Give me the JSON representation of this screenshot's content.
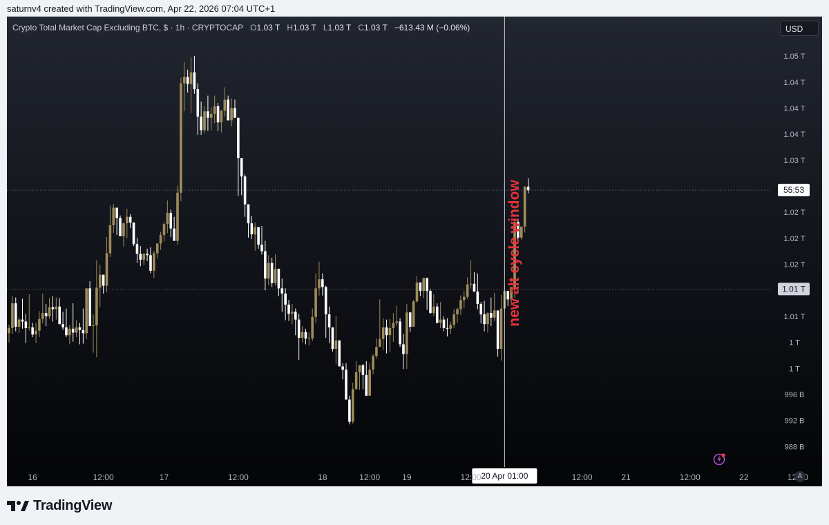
{
  "header": {
    "caption": "saturnv4 created with TradingView.com, Apr 22, 2026 07:04 UTC+1"
  },
  "legend": {
    "title": "Crypto Total Market Cap Excluding BTC, $ · 1h · CRYPTOCAP",
    "open_label": "O",
    "open_value": "1.03 T",
    "high_label": "H",
    "high_value": "1.03 T",
    "low_label": "L",
    "low_value": "1.03 T",
    "close_label": "C",
    "close_value": "1.03 T",
    "change": "−613.43 M (−0.06%)"
  },
  "currency_button": "USD",
  "auto_button": "A",
  "brand": {
    "name": "TradingView"
  },
  "colors": {
    "up_candle": "#a08c5b",
    "down_candle": "#ffffff",
    "annotation": "#e8323b",
    "crosshair": "#cfd2d8",
    "frame_bg": "#16181f"
  },
  "chart_data": {
    "type": "candlestick",
    "title": "Crypto Total Market Cap Excluding BTC, $ · 1h · CRYPTOCAP",
    "y_unit": "USD",
    "ylim": [
      986,
      1055
    ],
    "y_tick_labels": [
      {
        "value": 1050,
        "label": "1.05 T"
      },
      {
        "value": 1046,
        "label": "1.04 T"
      },
      {
        "value": 1042,
        "label": "1.04 T"
      },
      {
        "value": 1038,
        "label": "1.04 T"
      },
      {
        "value": 1034,
        "label": "1.03 T"
      },
      {
        "value": 1026,
        "label": "1.02 T"
      },
      {
        "value": 1022,
        "label": "1.02 T"
      },
      {
        "value": 1018,
        "label": "1.02 T"
      },
      {
        "value": 1010,
        "label": "1.01 T"
      },
      {
        "value": 1006,
        "label": "1 T"
      },
      {
        "value": 1002,
        "label": "1 T"
      },
      {
        "value": 998,
        "label": "996 B"
      },
      {
        "value": 994,
        "label": "992 B"
      },
      {
        "value": 990,
        "label": "988 B"
      }
    ],
    "x_tick_labels": [
      {
        "bar": 7,
        "label": "16"
      },
      {
        "bar": 28,
        "label": "12:00"
      },
      {
        "bar": 46,
        "label": "17"
      },
      {
        "bar": 68,
        "label": "12:00"
      },
      {
        "bar": 93,
        "label": "18"
      },
      {
        "bar": 107,
        "label": "12:00"
      },
      {
        "bar": 118,
        "label": "19"
      },
      {
        "bar": 137,
        "label": "12:00"
      },
      {
        "bar": 170,
        "label": "12:00"
      },
      {
        "bar": 183,
        "label": "21"
      },
      {
        "bar": 202,
        "label": "12:00"
      },
      {
        "bar": 218,
        "label": "22"
      },
      {
        "bar": 234,
        "label": "12:00"
      }
    ],
    "crosshair": {
      "bar": 147,
      "x_label": "20 Apr   01:00"
    },
    "price_labels": [
      {
        "value": 1029.4,
        "label": "55:53",
        "style": "current"
      },
      {
        "value": 1014.2,
        "label": "1.01 T",
        "style": "marker"
      }
    ],
    "annotation": {
      "text": "new alt cycle window",
      "bar": 150,
      "value": 1018
    },
    "candles": [
      [
        1007.4,
        1008.7,
        1006.0,
        1008.2
      ],
      [
        1008.2,
        1013.1,
        1007.3,
        1012.0
      ],
      [
        1012.0,
        1012.9,
        1007.7,
        1008.4
      ],
      [
        1008.4,
        1009.8,
        1007.4,
        1009.5
      ],
      [
        1009.5,
        1012.7,
        1008.1,
        1009.2
      ],
      [
        1009.2,
        1010.4,
        1005.9,
        1008.2
      ],
      [
        1008.2,
        1013.4,
        1007.8,
        1008.3
      ],
      [
        1008.3,
        1009.0,
        1006.8,
        1007.2
      ],
      [
        1007.2,
        1009.0,
        1005.9,
        1007.8
      ],
      [
        1007.8,
        1010.8,
        1006.8,
        1009.6
      ],
      [
        1009.6,
        1013.5,
        1008.9,
        1010.5
      ],
      [
        1010.5,
        1011.9,
        1008.5,
        1010.0
      ],
      [
        1010.0,
        1012.8,
        1009.6,
        1011.4
      ],
      [
        1011.4,
        1013.1,
        1009.2,
        1011.1
      ],
      [
        1011.1,
        1012.9,
        1009.5,
        1011.5
      ],
      [
        1011.5,
        1012.8,
        1008.8,
        1008.8
      ],
      [
        1008.8,
        1010.7,
        1007.9,
        1008.3
      ],
      [
        1008.3,
        1011.2,
        1006.8,
        1007.1
      ],
      [
        1007.1,
        1008.7,
        1005.7,
        1008.1
      ],
      [
        1008.1,
        1012.0,
        1006.1,
        1007.5
      ],
      [
        1007.5,
        1009.4,
        1006.8,
        1008.3
      ],
      [
        1008.3,
        1009.0,
        1005.7,
        1007.9
      ],
      [
        1007.9,
        1011.2,
        1005.8,
        1007.4
      ],
      [
        1007.4,
        1014.1,
        1006.5,
        1014.3
      ],
      [
        1014.3,
        1015.4,
        1008.6,
        1008.5
      ],
      [
        1008.5,
        1010.3,
        1004.4,
        1008.6
      ],
      [
        1008.6,
        1018.6,
        1003.7,
        1014.4
      ],
      [
        1014.4,
        1017.9,
        1011.4,
        1016.4
      ],
      [
        1016.4,
        1015.8,
        1013.5,
        1014.7
      ],
      [
        1014.7,
        1022.2,
        1013.7,
        1019.7
      ],
      [
        1019.7,
        1027.0,
        1019.1,
        1024.0
      ],
      [
        1024.0,
        1027.3,
        1022.8,
        1026.7
      ],
      [
        1026.7,
        1026.7,
        1022.5,
        1025.1
      ],
      [
        1025.1,
        1025.5,
        1022.3,
        1022.3
      ],
      [
        1022.3,
        1024.4,
        1020.7,
        1024.3
      ],
      [
        1024.3,
        1026.5,
        1022.0,
        1025.3
      ],
      [
        1025.3,
        1025.7,
        1023.6,
        1024.4
      ],
      [
        1024.4,
        1024.2,
        1020.8,
        1021.1
      ],
      [
        1021.1,
        1022.1,
        1018.2,
        1019.6
      ],
      [
        1019.6,
        1020.8,
        1017.7,
        1018.7
      ],
      [
        1018.7,
        1019.7,
        1017.9,
        1019.6
      ],
      [
        1019.6,
        1020.4,
        1018.5,
        1019.4
      ],
      [
        1019.4,
        1020.6,
        1016.6,
        1017.0
      ],
      [
        1017.0,
        1020.0,
        1015.9,
        1019.7
      ],
      [
        1019.7,
        1021.2,
        1018.9,
        1021.2
      ],
      [
        1021.2,
        1023.0,
        1020.2,
        1022.5
      ],
      [
        1022.5,
        1024.5,
        1021.5,
        1024.2
      ],
      [
        1024.2,
        1027.8,
        1022.8,
        1025.9
      ],
      [
        1025.9,
        1026.4,
        1022.2,
        1023.5
      ],
      [
        1023.5,
        1025.3,
        1022.9,
        1021.6
      ],
      [
        1021.6,
        1030.1,
        1021.0,
        1029.0
      ],
      [
        1029.0,
        1046.7,
        1027.7,
        1045.8
      ],
      [
        1045.8,
        1049.1,
        1041.5,
        1046.8
      ],
      [
        1046.8,
        1047.9,
        1044.4,
        1045.7
      ],
      [
        1045.7,
        1049.8,
        1041.2,
        1047.5
      ],
      [
        1047.5,
        1050.0,
        1044.2,
        1044.9
      ],
      [
        1044.9,
        1045.8,
        1037.9,
        1040.7
      ],
      [
        1040.7,
        1043.0,
        1037.9,
        1038.6
      ],
      [
        1038.6,
        1042.3,
        1038.2,
        1041.5
      ],
      [
        1041.5,
        1043.9,
        1038.5,
        1040.5
      ],
      [
        1040.5,
        1042.1,
        1038.6,
        1041.1
      ],
      [
        1041.1,
        1043.9,
        1039.7,
        1042.3
      ],
      [
        1042.3,
        1042.8,
        1038.5,
        1039.8
      ],
      [
        1039.8,
        1041.7,
        1038.3,
        1041.6
      ],
      [
        1041.6,
        1045.2,
        1040.7,
        1043.3
      ],
      [
        1043.3,
        1043.9,
        1040.3,
        1040.1
      ],
      [
        1040.1,
        1043.5,
        1039.2,
        1042.0
      ],
      [
        1042.0,
        1043.3,
        1040.5,
        1040.5
      ],
      [
        1040.5,
        1040.4,
        1028.5,
        1034.3
      ],
      [
        1034.3,
        1034.0,
        1028.6,
        1031.5
      ],
      [
        1031.5,
        1031.8,
        1025.3,
        1027.2
      ],
      [
        1027.2,
        1027.2,
        1022.1,
        1024.3
      ],
      [
        1024.3,
        1025.4,
        1021.9,
        1022.6
      ],
      [
        1022.6,
        1024.4,
        1020.1,
        1023.7
      ],
      [
        1023.7,
        1023.7,
        1020.4,
        1021.0
      ],
      [
        1021.0,
        1023.9,
        1019.5,
        1020.0
      ],
      [
        1020.0,
        1021.6,
        1014.0,
        1015.8
      ],
      [
        1015.8,
        1019.4,
        1014.8,
        1018.2
      ],
      [
        1018.2,
        1019.0,
        1014.5,
        1015.1
      ],
      [
        1015.1,
        1019.5,
        1014.7,
        1017.3
      ],
      [
        1017.3,
        1016.7,
        1013.1,
        1014.3
      ],
      [
        1014.3,
        1015.8,
        1010.7,
        1013.5
      ],
      [
        1013.5,
        1014.3,
        1009.4,
        1011.8
      ],
      [
        1011.8,
        1012.5,
        1009.3,
        1010.4
      ],
      [
        1010.4,
        1011.9,
        1008.8,
        1010.7
      ],
      [
        1010.7,
        1011.2,
        1007.1,
        1009.5
      ],
      [
        1009.5,
        1010.4,
        1003.3,
        1006.7
      ],
      [
        1006.7,
        1008.5,
        1006.0,
        1007.6
      ],
      [
        1007.6,
        1008.1,
        1005.7,
        1006.6
      ],
      [
        1006.6,
        1007.5,
        1005.5,
        1006.6
      ],
      [
        1006.6,
        1011.2,
        1006.2,
        1009.9
      ],
      [
        1009.9,
        1016.6,
        1009.0,
        1014.3
      ],
      [
        1014.3,
        1018.4,
        1013.2,
        1015.7
      ],
      [
        1015.7,
        1016.6,
        1013.2,
        1014.5
      ],
      [
        1014.5,
        1014.7,
        1006.7,
        1010.3
      ],
      [
        1010.3,
        1011.5,
        1005.9,
        1008.3
      ],
      [
        1008.3,
        1007.9,
        1004.6,
        1005.0
      ],
      [
        1005.0,
        1010.1,
        1002.6,
        1006.3
      ],
      [
        1006.3,
        1005.7,
        1002.9,
        1002.3
      ],
      [
        1002.3,
        1002.8,
        1000.3,
        1001.8
      ],
      [
        1001.8,
        1002.8,
        997.4,
        997.2
      ],
      [
        997.2,
        997.8,
        993.4,
        993.8
      ],
      [
        993.8,
        999.8,
        993.5,
        998.8
      ],
      [
        998.8,
        1003.1,
        1000.4,
        1001.4
      ],
      [
        1001.4,
        1001.8,
        998.7,
        1002.5
      ],
      [
        1002.5,
        1002.7,
        998.8,
        1001.0
      ],
      [
        1001.0,
        1003.1,
        998.4,
        997.8
      ],
      [
        997.8,
        1002.8,
        999.3,
        1001.8
      ],
      [
        1001.8,
        1004.2,
        1001.1,
        1003.9
      ],
      [
        1003.9,
        1006.6,
        1003.5,
        1005.3
      ],
      [
        1005.3,
        1012.6,
        1005.3,
        1006.5
      ],
      [
        1006.5,
        1009.7,
        1004.8,
        1008.3
      ],
      [
        1008.3,
        1009.5,
        1004.3,
        1007.1
      ],
      [
        1007.1,
        1009.6,
        1004.5,
        1008.2
      ],
      [
        1008.2,
        1010.5,
        1006.1,
        1009.0
      ],
      [
        1009.0,
        1011.6,
        1008.5,
        1009.2
      ],
      [
        1009.2,
        1009.7,
        1005.3,
        1005.7
      ],
      [
        1005.7,
        1007.3,
        1001.9,
        1004.2
      ],
      [
        1004.2,
        1011.9,
        1001.9,
        1010.6
      ],
      [
        1010.6,
        1010.1,
        1007.6,
        1008.4
      ],
      [
        1008.4,
        1012.5,
        1008.9,
        1012.3
      ],
      [
        1012.3,
        1016.2,
        1012.1,
        1015.2
      ],
      [
        1015.2,
        1015.2,
        1013.1,
        1013.9
      ],
      [
        1013.9,
        1015.6,
        1012.8,
        1015.9
      ],
      [
        1015.9,
        1015.4,
        1011.0,
        1013.9
      ],
      [
        1013.9,
        1014.2,
        1010.4,
        1010.5
      ],
      [
        1010.5,
        1013.4,
        1010.0,
        1011.5
      ],
      [
        1011.5,
        1012.0,
        1008.9,
        1009.0
      ],
      [
        1009.0,
        1012.2,
        1008.2,
        1009.5
      ],
      [
        1009.5,
        1010.0,
        1007.7,
        1008.2
      ],
      [
        1008.2,
        1009.7,
        1006.9,
        1008.1
      ],
      [
        1008.1,
        1009.2,
        1007.3,
        1008.7
      ],
      [
        1008.7,
        1011.1,
        1008.2,
        1010.3
      ],
      [
        1010.3,
        1011.3,
        1009.0,
        1011.1
      ],
      [
        1011.1,
        1013.2,
        1010.2,
        1012.5
      ],
      [
        1012.5,
        1013.9,
        1011.3,
        1013.0
      ],
      [
        1013.0,
        1016.0,
        1012.7,
        1014.9
      ],
      [
        1014.9,
        1018.6,
        1014.3,
        1015.0
      ],
      [
        1015.0,
        1016.8,
        1013.9,
        1013.8
      ],
      [
        1013.8,
        1016.6,
        1011.1,
        1011.9
      ],
      [
        1011.9,
        1012.2,
        1008.9,
        1010.3
      ],
      [
        1010.3,
        1012.4,
        1007.7,
        1008.8
      ],
      [
        1008.8,
        1010.6,
        1007.5,
        1010.5
      ],
      [
        1010.5,
        1012.9,
        1008.5,
        1009.8
      ],
      [
        1009.8,
        1013.6,
        1009.3,
        1010.9
      ],
      [
        1010.9,
        1010.6,
        1003.8,
        1005.0
      ],
      [
        1005.0,
        1013.3,
        1003.2,
        1011.2
      ],
      [
        1011.2,
        1014.7,
        1010.6,
        1013.9
      ],
      [
        1013.9,
        1013.5,
        1011.6,
        1012.6
      ],
      [
        1012.6,
        1013.8,
        1011.8,
        1014.5
      ],
      [
        1014.5,
        1025.0,
        1012.9,
        1024.5
      ],
      [
        1024.5,
        1024.7,
        1021.9,
        1022.1
      ],
      [
        1022.1,
        1023.3,
        1021.8,
        1023.8
      ],
      [
        1023.8,
        1030.0,
        1022.9,
        1029.9
      ],
      [
        1029.9,
        1031.2,
        1028.9,
        1029.4
      ]
    ]
  }
}
